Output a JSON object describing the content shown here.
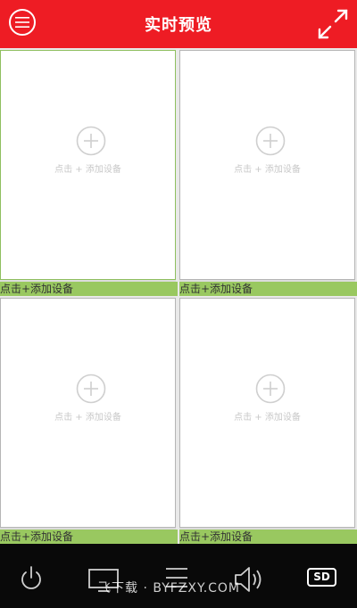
{
  "header": {
    "title": "实时预览",
    "menu_icon": "menu-icon",
    "fullscreen_icon": "fullscreen-icon",
    "background": "#ee1c24"
  },
  "grid": {
    "cells": [
      {
        "hint": "点击 + 添加设备",
        "label": "点击+添加设备"
      },
      {
        "hint": "点击 + 添加设备",
        "label": "点击+添加设备"
      },
      {
        "hint": "点击 + 添加设备",
        "label": "点击+添加设备"
      },
      {
        "hint": "点击 + 添加设备",
        "label": "点击+添加设备"
      }
    ],
    "label_bar_color": "#99c860"
  },
  "toolbar": {
    "power_icon": "power-icon",
    "screen_icon": "screen-icon",
    "list_icon": "list-icon",
    "sound_icon": "speaker-icon",
    "sd_label": "SD",
    "background": "#090909"
  },
  "watermark": "飞下载 · BYFZXY.COM"
}
